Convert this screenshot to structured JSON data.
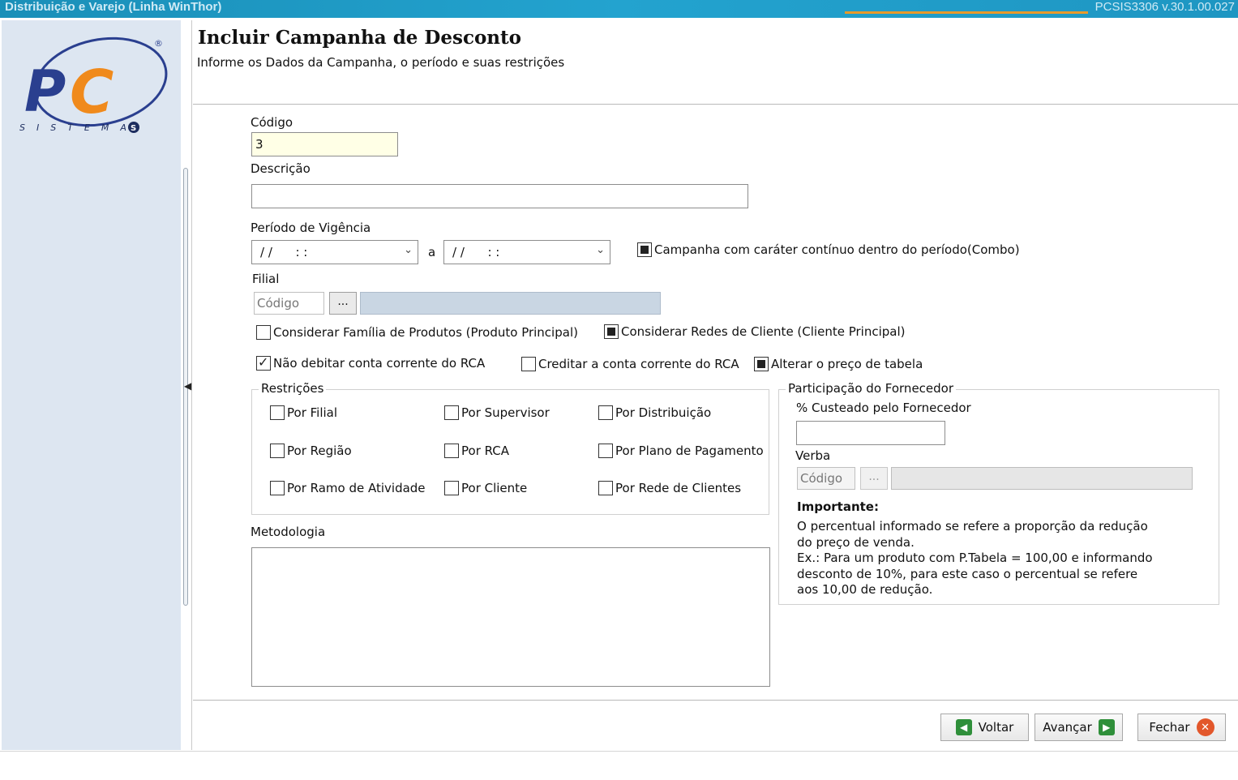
{
  "window": {
    "title": "Distribuição e Varejo (Linha WinThor)",
    "version": "PCSIS3306 v.30.1.00.027"
  },
  "logo": {
    "brand": "PC",
    "subtitle": "SISTEMAS",
    "colors": {
      "blue": "#2a3f8f",
      "orange": "#f08a1c"
    }
  },
  "header": {
    "title": "Incluir Campanha de Desconto",
    "subtitle": "Informe os Dados da Campanha, o período e suas restrições"
  },
  "form": {
    "codigo_label": "Código",
    "codigo_value": "3",
    "descricao_label": "Descrição",
    "descricao_value": "",
    "periodo_label": "Período de Vigência",
    "periodo_start": "/ /      : :",
    "periodo_sep": "a",
    "periodo_end": "/ /      : :",
    "continuo_label": "Campanha com caráter contínuo dentro do período(Combo)",
    "filial_label": "Filial",
    "filial_placeholder": "Código",
    "dots": "...",
    "familia_label": "Considerar Família de Produtos (Produto Principal)",
    "redes_label": "Considerar Redes de Cliente (Cliente Principal)",
    "nao_debitar_label": "Não debitar conta corrente do RCA",
    "creditar_label": "Creditar a conta corrente do RCA",
    "alterar_preco_label": "Alterar o preço de tabela"
  },
  "restricoes": {
    "title": "Restrições",
    "items": [
      "Por Filial",
      "Por Supervisor",
      "Por Distribuição",
      "Por Região",
      "Por RCA",
      "Por Plano de Pagamento",
      "Por Ramo de Atividade",
      "Por Cliente",
      "Por Rede de Clientes"
    ]
  },
  "metodologia": {
    "label": "Metodologia",
    "value": ""
  },
  "fornecedor": {
    "title": "Participação do Fornecedor",
    "custeado_label": "% Custeado pelo Fornecedor",
    "custeado_value": "",
    "verba_label": "Verba",
    "verba_placeholder": "Código",
    "dots": "...",
    "importante_title": "Importante:",
    "importante_lines": [
      "O percentual informado se refere a proporção da redução",
      "do preço de venda.",
      "Ex.: Para um produto com P.Tabela = 100,00 e informando",
      "desconto de 10%, para este caso o percentual se refere",
      "aos 10,00 de redução."
    ]
  },
  "buttons": {
    "voltar": "Voltar",
    "avancar": "Avançar",
    "fechar": "Fechar"
  }
}
